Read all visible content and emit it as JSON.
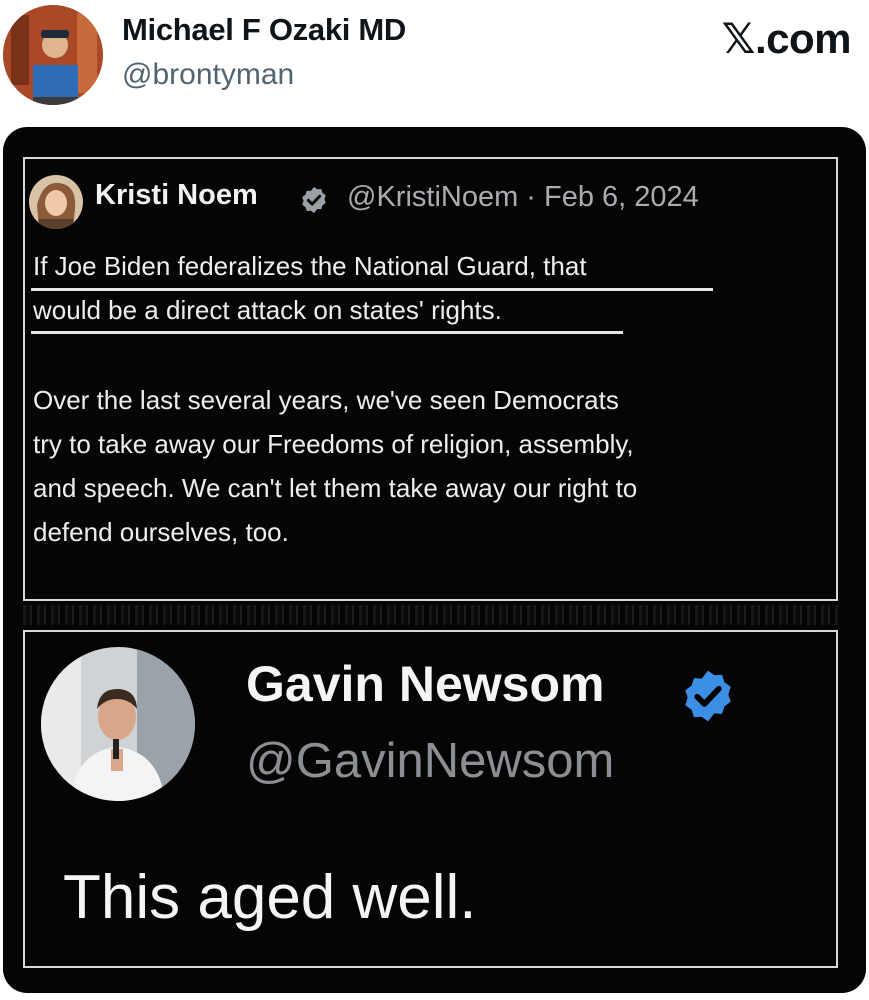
{
  "post": {
    "author_name": "Michael F Ozaki MD",
    "author_handle": "@brontyman",
    "site_label": ".com",
    "site_icon": "x-logo-icon"
  },
  "meme": {
    "tweet_1": {
      "name": "Kristi Noem",
      "meta": "@KristiNoem · Feb 6, 2024",
      "verified_icon": "verified-badge-icon",
      "badge_color": "#9aa0a6",
      "lines": [
        "If Joe Biden federalizes the National Guard, that",
        "would be a direct attack on states' rights.",
        "Over the last several years, we've seen Democrats",
        "try to take away our Freedoms of religion, assembly,",
        "and speech. We can't let them take away our right to",
        "defend ourselves, too."
      ]
    },
    "tweet_2": {
      "name": "Gavin Newsom",
      "handle": "@GavinNewsom",
      "verified_icon": "verified-badge-icon",
      "badge_color": "#3b8fe4",
      "text": "This aged well."
    }
  }
}
